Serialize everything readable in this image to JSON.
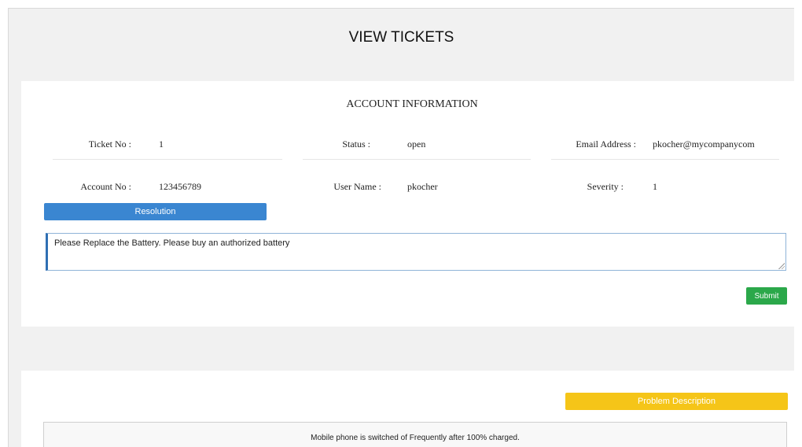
{
  "page": {
    "title": "VIEW TICKETS"
  },
  "account": {
    "section_title": "ACCOUNT INFORMATION",
    "ticket_no": {
      "label": "Ticket No :",
      "value": "1"
    },
    "status": {
      "label": "Status :",
      "value": "open"
    },
    "email": {
      "label": "Email Address :",
      "value": "pkocher@mycompanycom"
    },
    "account_no": {
      "label": "Account No :",
      "value": "123456789"
    },
    "user_name": {
      "label": "User Name :",
      "value": "pkocher"
    },
    "severity": {
      "label": "Severity :",
      "value": "1"
    }
  },
  "resolution": {
    "header": "Resolution",
    "text": "Please Replace the Battery. Please buy an authorized battery",
    "submit_label": "Submit"
  },
  "problem": {
    "header": "Problem Description",
    "text": "Mobile phone is switched of Frequently after 100% charged."
  },
  "colors": {
    "resolution_bar": "#3a86d1",
    "submit_button": "#2ba84a",
    "problem_bar": "#f5c518"
  }
}
